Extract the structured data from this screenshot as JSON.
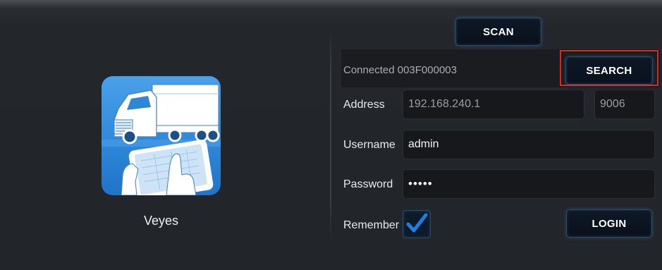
{
  "app": {
    "name": "Veyes",
    "icon": "truck-tablet-app-icon"
  },
  "toolbar": {
    "scan_label": "SCAN",
    "search_label": "SEARCH"
  },
  "connection": {
    "status_text": "Connected 003F000003"
  },
  "form": {
    "address_label": "Address",
    "address_value": "192.168.240.1",
    "port_value": "9006",
    "username_label": "Username",
    "username_value": "admin",
    "password_label": "Password",
    "password_value": "•••••",
    "remember_label": "Remember",
    "remember_checked": true,
    "login_label": "LOGIN"
  },
  "colors": {
    "highlight_border": "#d9291f",
    "accent_blue": "#1e7fe0",
    "background": "#23262b"
  }
}
